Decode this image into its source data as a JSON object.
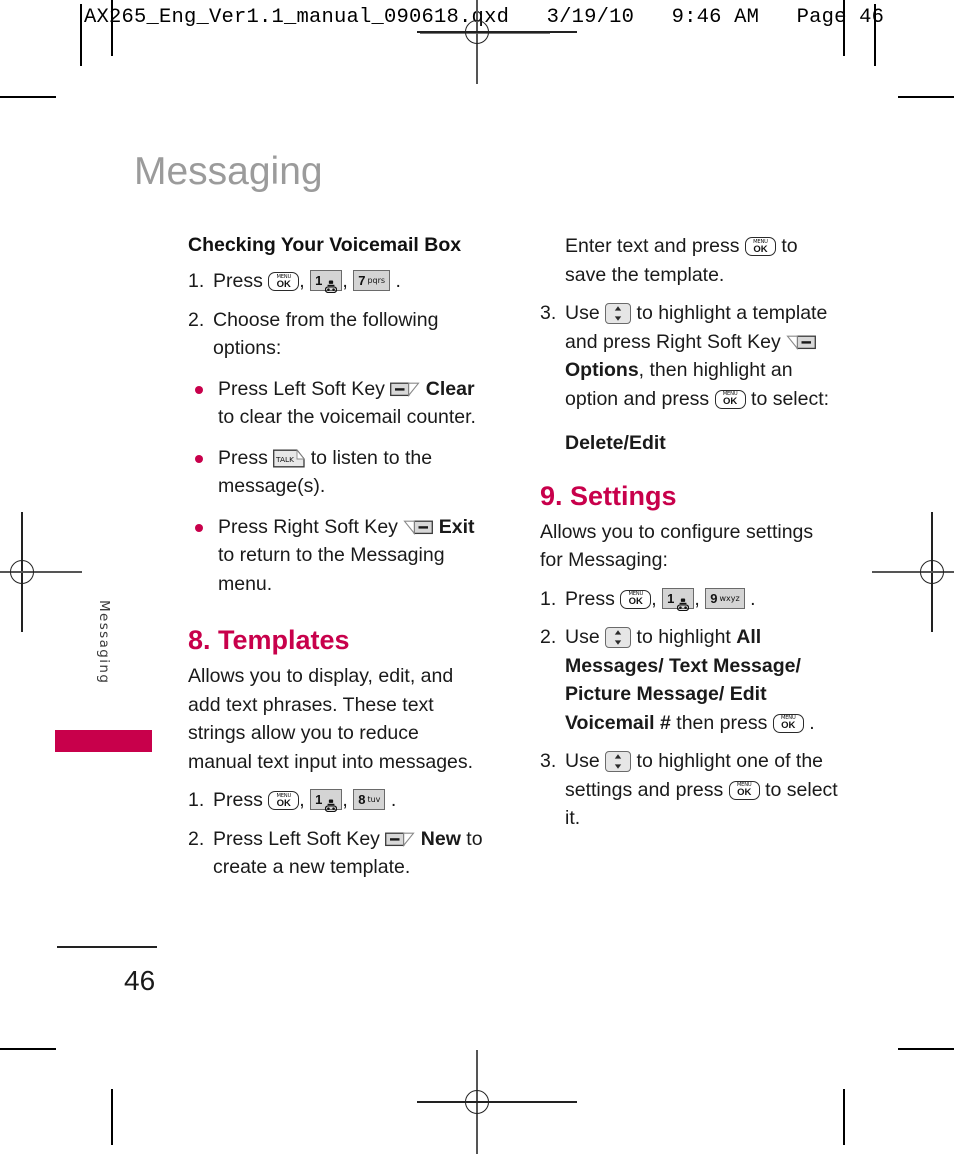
{
  "printer_marks": {
    "slug_line": "AX265_Eng_Ver1.1_manual_090618.qxd   3/19/10   9:46 AM   Page 46"
  },
  "page": {
    "title": "Messaging",
    "side_tab_label": "Messaging",
    "folio": "46",
    "accent_color": "#C8004B",
    "title_color": "#9b9b9b"
  },
  "left_column": {
    "subheading": "Checking Your Voicemail Box",
    "step1": {
      "num": "1.",
      "press_label": "Press",
      "keys": [
        "MENU/OK",
        "1",
        "7 pqrs"
      ],
      "key1_top": "MENU",
      "key1_bottom": "OK",
      "key2_digit": "1",
      "key3_digit": "7",
      "key3_letters": "pqrs",
      "comma": ",",
      "period": "."
    },
    "step2": {
      "num": "2.",
      "text": "Choose from the following options:"
    },
    "bullets": [
      {
        "before": "Press Left Soft Key",
        "icon": "left-soft-key",
        "bold": "Clear",
        "after": "to clear the voicemail counter."
      },
      {
        "before": "Press",
        "icon": "talk-key",
        "bold": "",
        "after": "to listen to the message(s)."
      },
      {
        "before": "Press Right Soft Key",
        "icon": "right-soft-key",
        "bold": "Exit",
        "after": "to return to the Messaging menu."
      }
    ],
    "section_templates": {
      "heading": "8. Templates",
      "lead": "Allows you to display, edit, and add text phrases. These text strings allow you to reduce manual text input into messages.",
      "step1": {
        "num": "1.",
        "press_label": "Press",
        "key1_top": "MENU",
        "key1_bottom": "OK",
        "key2_digit": "1",
        "key3_digit": "8",
        "key3_letters": "tuv",
        "period": "."
      },
      "step2": {
        "num": "2.",
        "before": "Press Left Soft Key",
        "bold": "New",
        "after": "to create a new template."
      }
    }
  },
  "right_column": {
    "continued_text": "Enter text and press",
    "continued_key_top": "MENU",
    "continued_key_bottom": "OK",
    "continued_tail": "to save the template.",
    "step3": {
      "num": "3.",
      "use_label": "Use",
      "part1": "to highlight a template and press Right Soft",
      "key_label": "Key",
      "bold_options": "Options",
      "part2": ", then highlight an option and press",
      "part3": "to select:",
      "result": "Delete/Edit"
    },
    "section_settings": {
      "heading": "9. Settings",
      "lead": "Allows you to configure settings for Messaging:",
      "step1": {
        "num": "1.",
        "press_label": "Press",
        "key1_top": "MENU",
        "key1_bottom": "OK",
        "key2_digit": "1",
        "key3_digit": "9",
        "key3_letters": "wxyz",
        "period": "."
      },
      "step2": {
        "num": "2.",
        "use_label": "Use",
        "part1": "to highlight",
        "bold": "All Messages/ Text Message/ Picture Message/ Edit Voicemail #",
        "part2": "then press",
        "period": "."
      },
      "step3": {
        "num": "3.",
        "use_label": "Use",
        "part1": "to highlight one of the settings and press",
        "part2": "to select it."
      }
    }
  }
}
